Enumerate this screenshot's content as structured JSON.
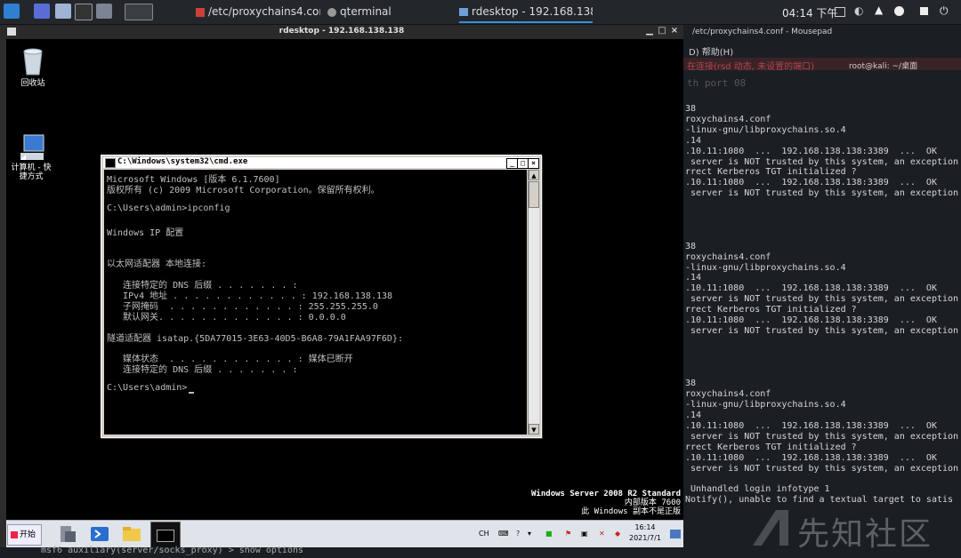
{
  "topbar": {
    "tasks": [
      {
        "label": "/etc/proxychains4.conf - ..."
      },
      {
        "label": "qterminal"
      },
      {
        "label": "rdesktop - 192.168.138.1..."
      }
    ],
    "clock": "04:14 下午"
  },
  "rdp": {
    "title": "rdesktop - 192.168.138.138"
  },
  "desktop_icons": [
    {
      "label": "回收站"
    },
    {
      "label": "计算机 - 快\n捷方式"
    }
  ],
  "cmd": {
    "title": "C:\\Windows\\system32\\cmd.exe",
    "lines": [
      "Microsoft Windows [版本 6.1.7600]",
      "版权所有 (c) 2009 Microsoft Corporation。保留所有权利。",
      "",
      "C:\\Users\\admin>ipconfig",
      "",
      "Windows IP 配置",
      "",
      "",
      "以太网适配器 本地连接:",
      "",
      "   连接特定的 DNS 后缀 . . . . . . . :",
      "   IPv4 地址 . . . . . . . . . . . . : 192.168.138.138",
      "   子网掩码  . . . . . . . . . . . . : 255.255.255.0",
      "   默认网关. . . . . . . . . . . . . : 0.0.0.0",
      "",
      "隧道适配器 isatap.{5DA77015-3E63-40D5-B6A8-79A1FAA97F6D}:",
      "",
      "   媒体状态  . . . . . . . . . . . . : 媒体已断开",
      "   连接特定的 DNS 后缀 . . . . . . . :",
      "",
      "C:\\Users\\admin>"
    ]
  },
  "watermark": {
    "line1": "Windows Server 2008 R2 Standard",
    "line2": "内部版本 7600",
    "line3": "此 Windows 副本不是正版"
  },
  "wtaskbar": {
    "start_label": "开始",
    "lang": "CH",
    "time": "16:14",
    "date": "2021/7/1"
  },
  "mousepad": {
    "title": "/etc/proxychains4.conf - Mousepad",
    "menu": "D)   帮助(H)"
  },
  "qterminal": {
    "title": "root@kali: ~/桌面",
    "red_line": "在连接(rsd 动态, 未设置的端口)",
    "dim_line": "th port 08",
    "lines": [
      "38",
      "roxychains4.conf",
      "-linux-gnu/libproxychains.so.4",
      ".14",
      ".10.11:1080  ...  192.168.138.138:3389  ...  OK",
      " server is NOT trusted by this system, an exception",
      "rrect Kerberos TGT initialized ?",
      ".10.11:1080  ...  192.168.138.138:3389  ...  OK",
      " server is NOT trusted by this system, an exception",
      "",
      "",
      "",
      "",
      "38",
      "roxychains4.conf",
      "-linux-gnu/libproxychains.so.4",
      ".14",
      ".10.11:1080  ...  192.168.138.138:3389  ...  OK",
      " server is NOT trusted by this system, an exception",
      "rrect Kerberos TGT initialized ?",
      ".10.11:1080  ...  192.168.138.138:3389  ...  OK",
      " server is NOT trusted by this system, an exception",
      "",
      "",
      "",
      "",
      "38",
      "roxychains4.conf",
      "-linux-gnu/libproxychains.so.4",
      ".14",
      ".10.11:1080  ...  192.168.138.138:3389  ...  OK",
      " server is NOT trusted by this system, an exception",
      "rrect Kerberos TGT initialized ?",
      ".10.11:1080  ...  192.168.138.138:3389  ...  OK",
      " server is NOT trusted by this system, an exception",
      "",
      " Unhandled login infotype 1",
      "Notify(), unable to find a textual target to satis"
    ]
  },
  "bottom_line": "msf6 auxiliary(server/socks_proxy) > show options",
  "logo_text": "先知社区"
}
